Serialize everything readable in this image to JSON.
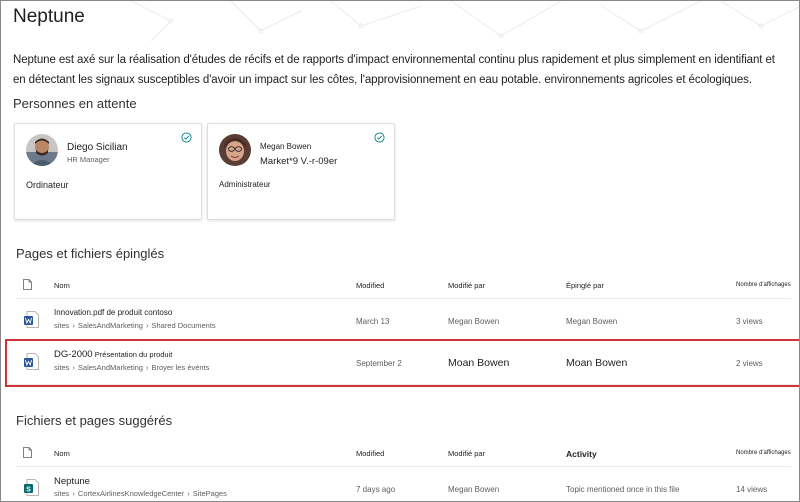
{
  "page": {
    "title": "Neptune",
    "description": "Neptune est axé sur la réalisation d'études de récifs et de rapports d'impact environnemental continu plus rapidement et plus simplement en identifiant et en détectant les signaux susceptibles d'avoir un impact sur les côtes, l'approvisionnement en eau potable. environnements agricoles et écologiques."
  },
  "people_section": {
    "title": "Personnes en attente",
    "cards": [
      {
        "name": "Diego Sicilian",
        "role": "HR Manager",
        "meta": "Ordinateur",
        "avatar": "avatar-diego"
      },
      {
        "name": "Megan Bowen",
        "role": "Market*9 V.-r-09er",
        "meta": "Administrateur",
        "avatar": "avatar-megan"
      }
    ]
  },
  "pinned_section": {
    "title": "Pages et fichiers épinglés",
    "headers": {
      "name": "Nom",
      "modified": "Modified",
      "modified_by": "Modifié par",
      "pinned_by": "Épinglé par",
      "views": "Nombre d'affichages"
    },
    "rows": [
      {
        "name": "Innovation.pdf de produit contoso",
        "path": [
          "sites",
          "SalesAndMarketing",
          "Shared Documents"
        ],
        "modified": "March 13",
        "modified_by": "Megan Bowen",
        "pinned_by": "Megan Bowen",
        "views": "3 views",
        "icon": "word-icon"
      },
      {
        "name_main": "DG-2000",
        "name_rest": "Présentation du produit",
        "path": [
          "sites",
          "SalesAndMarketing",
          "Broyer les événts"
        ],
        "modified": "September 2",
        "modified_by": "Moan Bowen",
        "pinned_by": "Moan Bowen",
        "views": "2 views",
        "icon": "word-icon"
      }
    ]
  },
  "suggested_section": {
    "title": "Fichiers et pages suggérés",
    "headers": {
      "name": "Nom",
      "modified": "Modified",
      "modified_by": "Modifié par",
      "activity": "Activity",
      "views": "Nombre d'affichages"
    },
    "rows": [
      {
        "name": "Neptune",
        "path": [
          "sites",
          "CortexAirlinesKnowledgeCenter",
          "SitePages"
        ],
        "modified": "7 days ago",
        "modified_by": "Megan Bowen",
        "activity": "Topic mentioned once in this file",
        "views": "14 views",
        "icon": "sharepoint-page-icon"
      }
    ]
  },
  "colors": {
    "highlight": "#d13438",
    "word": "#2b579a",
    "sharepoint": "#036c70",
    "check": "#038387"
  }
}
